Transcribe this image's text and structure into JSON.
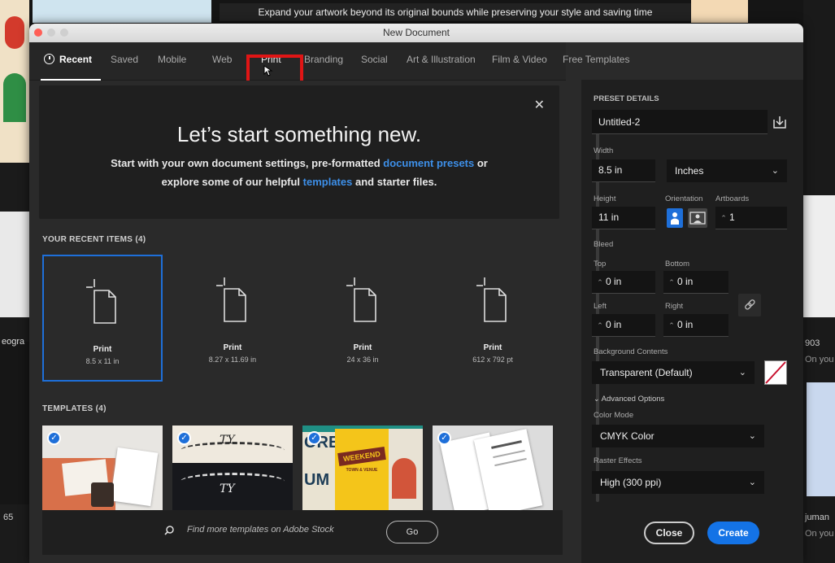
{
  "background": {
    "banner": "Expand your artwork beyond its original bounds while preserving your style and saving time",
    "side_texts": [
      "eogra",
      "65",
      "903",
      "On you",
      "On you",
      "juman",
      "On you"
    ]
  },
  "window": {
    "title": "New Document",
    "tabs": [
      "Recent",
      "Saved",
      "Mobile",
      "Web",
      "Print",
      "Branding",
      "Social",
      "Art & Illustration",
      "Film & Video",
      "Free Templates"
    ],
    "active_tab": "Recent",
    "highlighted_tab": "Print"
  },
  "hero": {
    "title": "Let’s start something new.",
    "line1_a": "Start with your own document settings, pre-formatted ",
    "line1_link": "document presets",
    "line1_b": " or",
    "line2_a": "explore some of our helpful ",
    "line2_link": "templates",
    "line2_b": " and starter files."
  },
  "recent": {
    "heading": "YOUR RECENT ITEMS",
    "count": "(4)",
    "items": [
      {
        "label": "Print",
        "size": "8.5 x 11 in"
      },
      {
        "label": "Print",
        "size": "8.27 x 11.69 in"
      },
      {
        "label": "Print",
        "size": "24 x 36 in"
      },
      {
        "label": "Print",
        "size": "612 x 792 pt"
      }
    ]
  },
  "templates": {
    "heading": "TEMPLATES",
    "count": "(4)",
    "thumb_texts": [
      "TY",
      "TY",
      "ORE",
      "UM",
      "WEEKEND",
      "TOWN & VENUE"
    ]
  },
  "search": {
    "placeholder": "Find more templates on Adobe Stock",
    "go_label": "Go"
  },
  "preset": {
    "heading": "PRESET DETAILS",
    "name": "Untitled-2",
    "width_label": "Width",
    "width_value": "8.5 in",
    "units": "Inches",
    "height_label": "Height",
    "height_value": "11 in",
    "orientation_label": "Orientation",
    "artboards_label": "Artboards",
    "artboards_value": "1",
    "bleed_label": "Bleed",
    "top_label": "Top",
    "top_value": "0 in",
    "bottom_label": "Bottom",
    "bottom_value": "0 in",
    "left_label": "Left",
    "left_value": "0 in",
    "right_label": "Right",
    "right_value": "0 in",
    "bg_label": "Background Contents",
    "bg_value": "Transparent (Default)",
    "advanced_label": "Advanced Options",
    "colormode_label": "Color Mode",
    "colormode_value": "CMYK Color",
    "raster_label": "Raster Effects",
    "raster_value": "High (300 ppi)",
    "close_label": "Close",
    "create_label": "Create"
  },
  "colors": {
    "accent": "#1473e6",
    "link": "#3d8fe8",
    "highlight": "#e01515"
  }
}
